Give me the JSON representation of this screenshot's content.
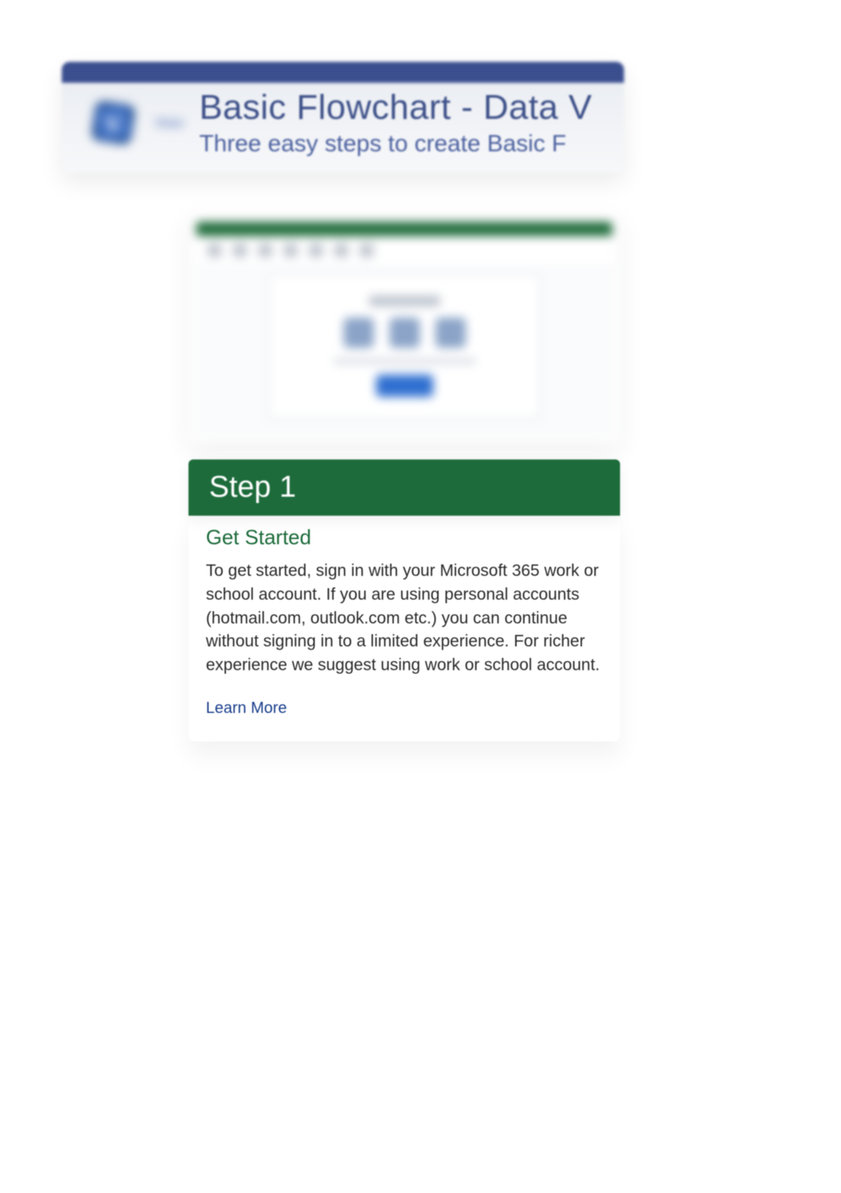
{
  "header": {
    "logo_name": "Visio",
    "title": "Basic Flowchart - Data V",
    "subtitle": "Three easy steps to create Basic F"
  },
  "step": {
    "number_label": "Step 1",
    "subtitle": "Get Started",
    "body": "To get started, sign in with your Microsoft 365 work or school account. If you are using personal accounts (hotmail.com, outlook.com etc.) you can continue without signing in to a limited experience. For richer experience we suggest using work or school account.",
    "learn_more": "Learn More"
  },
  "colors": {
    "header_bar": "#3b4f8f",
    "step_bar": "#1d6b3b",
    "link": "#1a3e8c"
  }
}
